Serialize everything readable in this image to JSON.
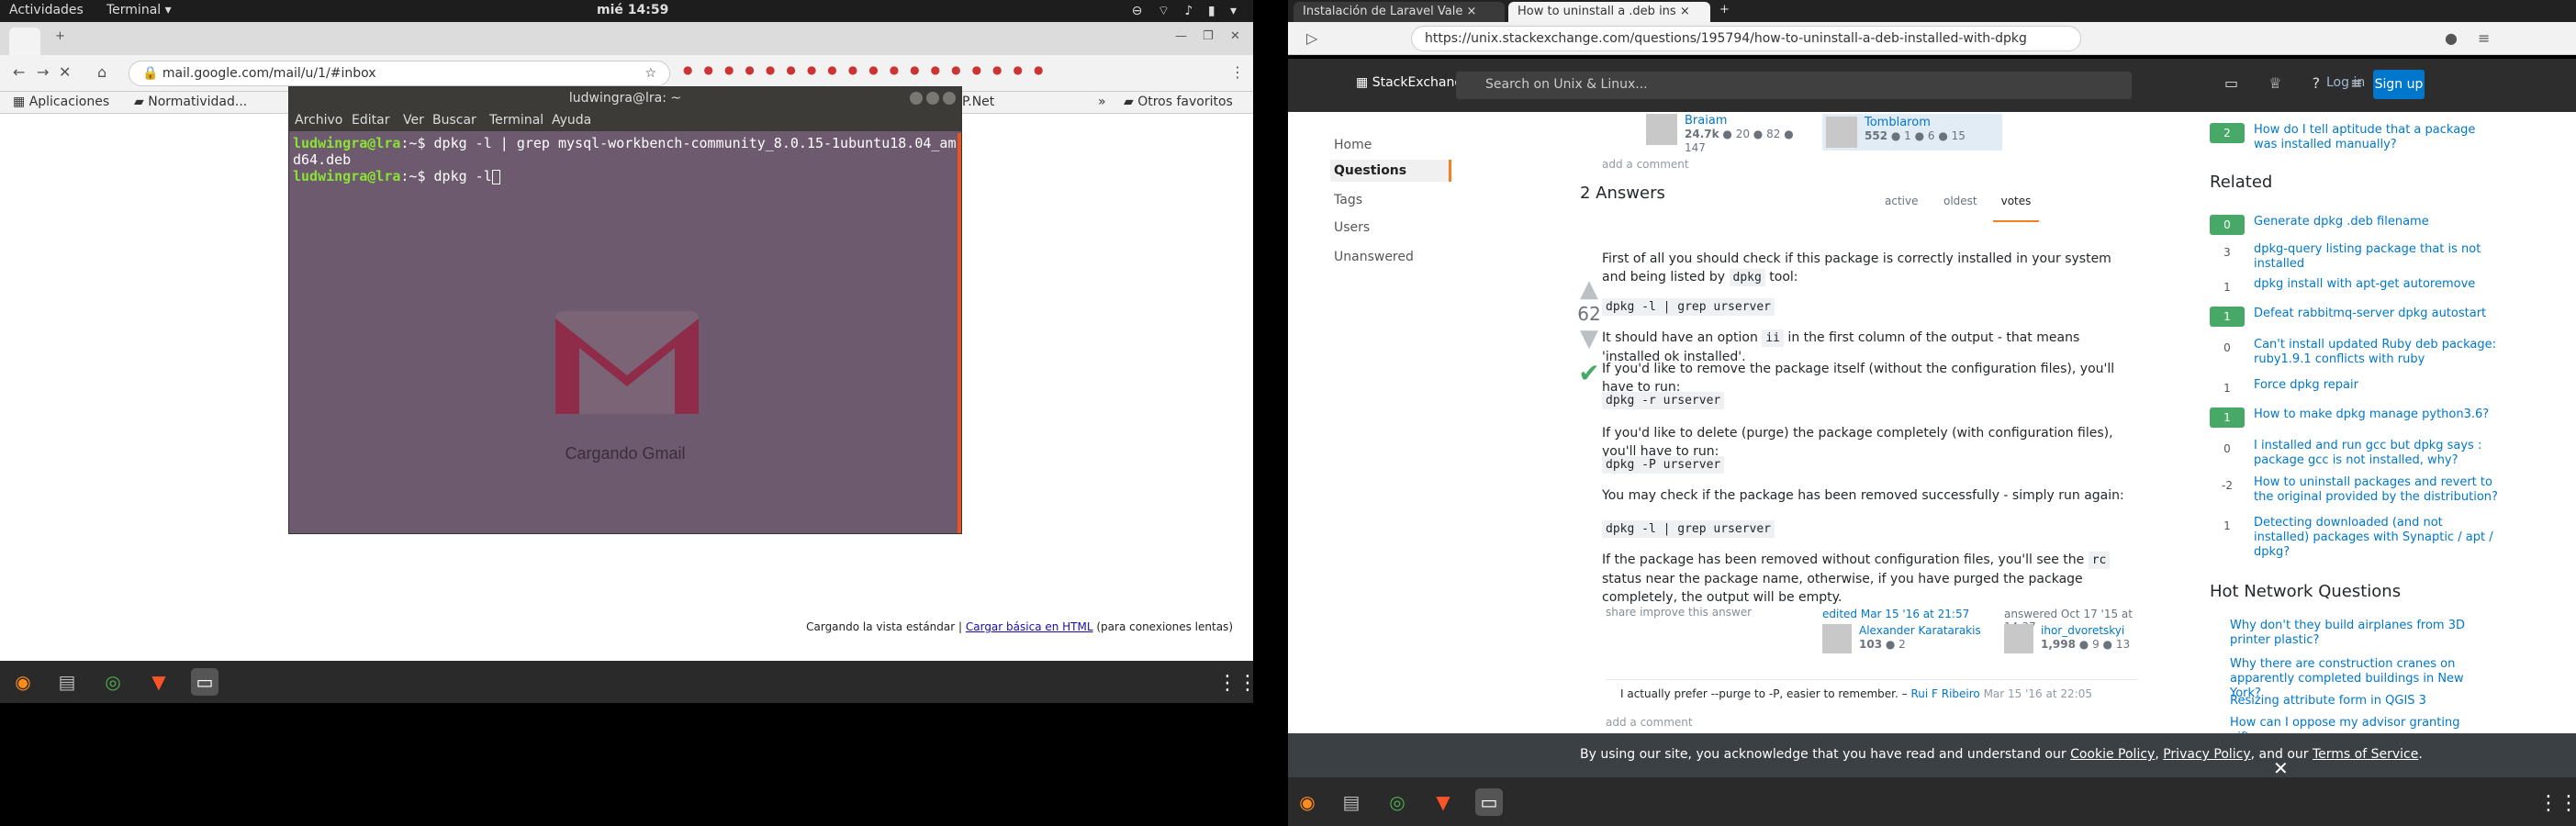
{
  "left": {
    "topbar": {
      "activities": "Actividades",
      "app_menu": "Terminal ▾",
      "clock": "mié 14:59"
    },
    "browser_tab": {
      "label": ""
    },
    "omnibox_url": "mail.google.com/mail/u/1/#inbox",
    "bookmarks": [
      "Aplicaciones",
      "Normatividad...",
      "P.Net",
      "Otros favoritos"
    ],
    "gmail_foot": {
      "text_before": "Cargando la vista estándar | ",
      "link": "Cargar básica en HTML",
      "text_after": " (para conexiones lentas)"
    },
    "terminal": {
      "title": "ludwingra@lra: ~",
      "menu": [
        "Archivo",
        "Editar",
        "Ver",
        "Buscar",
        "Terminal",
        "Ayuda"
      ],
      "lines": [
        {
          "prompt": "ludwingra@lra",
          "path": ":~$",
          "cmd": " dpkg -l | grep mysql-workbench-community_8.0.15-1ubuntu18.04_am"
        },
        {
          "prompt": "",
          "path": "",
          "cmd": "d64.deb"
        },
        {
          "prompt": "ludwingra@lra",
          "path": ":~$",
          "cmd": " dpkg -l"
        }
      ],
      "loading": "Cargando Gmail"
    }
  },
  "right": {
    "tabs": [
      "Instalación de Laravel Vale ×",
      "How to uninstall a .deb ins ×"
    ],
    "url": "https://unix.stackexchange.com/questions/195794/how-to-uninstall-a-deb-installed-with-dpkg",
    "header": {
      "logo": "StackExchange",
      "search_placeholder": "Search on Unix & Linux...",
      "login": "Log in",
      "signup": "Sign up"
    },
    "nav": [
      "Home",
      "Questions",
      "Tags",
      "Users",
      "Unanswered"
    ],
    "top_users": [
      {
        "name": "Braiam",
        "rep": "24.7k",
        "gold": "20",
        "silver": "82",
        "bronze": "147"
      },
      {
        "name": "Tomblarom",
        "rep": "552",
        "gold": "1",
        "silver": "6",
        "bronze": "15"
      }
    ],
    "add_comment": "add a comment",
    "answers_count": "2 Answers",
    "sort_tabs": [
      "active",
      "oldest",
      "votes"
    ],
    "answer": {
      "votes": "62",
      "p1": "First of all you should check if this package is correctly installed in your system and being listed by",
      "p1_code": "dpkg",
      "p1_end": " tool:",
      "code1": "dpkg -l | grep urserver",
      "p2_before": "It should have an option ",
      "p2_code": "ii",
      "p2_after": " in the first column of the output - that means 'installed ok installed'.",
      "p3": "If you'd like to remove the package itself (without the configuration files), you'll have to run:",
      "code2": "dpkg -r urserver",
      "p4": "If you'd like to delete (purge) the package completely (with configuration files), you'll have to run:",
      "code3": "dpkg -P urserver",
      "p5": "You may check if the package has been removed successfully - simply run again:",
      "code4": "dpkg -l | grep urserver",
      "p6_before": "If the package has been removed without configuration files, you'll see the ",
      "p6_code": "rc",
      "p6_after": " status near the package name, otherwise, if you have purged the package completely, the output will be empty.",
      "share": "share  improve this answer",
      "edited": "edited Mar 15 '16 at 21:57",
      "editor": {
        "name": "Alexander Karatarakis",
        "rep": "103",
        "bronze": "2"
      },
      "answered": "answered Oct 17 '15 at 14:37",
      "author": {
        "name": "ihor_dvoretskyi",
        "rep": "1,998",
        "silver": "9",
        "bronze": "13"
      },
      "comment": "I actually prefer --purge to -P, easier to remember. – ",
      "comment_user": "Rui F Ribeiro",
      "comment_time": " Mar 15 '16 at 22:05"
    },
    "sidebar": {
      "top_item": {
        "score": "2",
        "text": "How do I tell aptitude that a package was installed manually?"
      },
      "related_title": "Related",
      "related": [
        {
          "score": "0",
          "ok": true,
          "text": "Generate dpkg .deb filename"
        },
        {
          "score": "3",
          "ok": false,
          "text": "dpkg-query listing package that is not installed"
        },
        {
          "score": "1",
          "ok": false,
          "text": "dpkg install with apt-get autoremove"
        },
        {
          "score": "1",
          "ok": true,
          "text": "Defeat rabbitmq-server dpkg autostart"
        },
        {
          "score": "0",
          "ok": false,
          "text": "Can't install updated Ruby deb package: ruby1.9.1 conflicts with ruby"
        },
        {
          "score": "1",
          "ok": false,
          "text": "Force dpkg repair"
        },
        {
          "score": "1",
          "ok": true,
          "text": "How to make dpkg manage python3.6?"
        },
        {
          "score": "0",
          "ok": false,
          "text": "I installed and run gcc but dpkg says : package gcc is not installed, why?"
        },
        {
          "score": "-2",
          "ok": false,
          "text": "How to uninstall packages and revert to the original provided by the distribution?"
        },
        {
          "score": "1",
          "ok": false,
          "text": "Detecting downloaded (and not installed) packages with Synaptic / apt / dpkg?"
        }
      ],
      "hot_title": "Hot Network Questions",
      "hot": [
        "Why don't they build airplanes from 3D printer plastic?",
        "Why there are construction cranes on apparently completed buildings in New York?",
        "Resizing attribute form in QGIS 3",
        "How can I oppose my advisor granting gift"
      ]
    },
    "cookie": {
      "text": "By using our site, you acknowledge that you have read and understand our ",
      "cookie_policy": "Cookie Policy",
      "sep": ", ",
      "privacy": "Privacy Policy",
      "and": ", and our ",
      "terms": "Terms of Service",
      "end": "."
    }
  }
}
